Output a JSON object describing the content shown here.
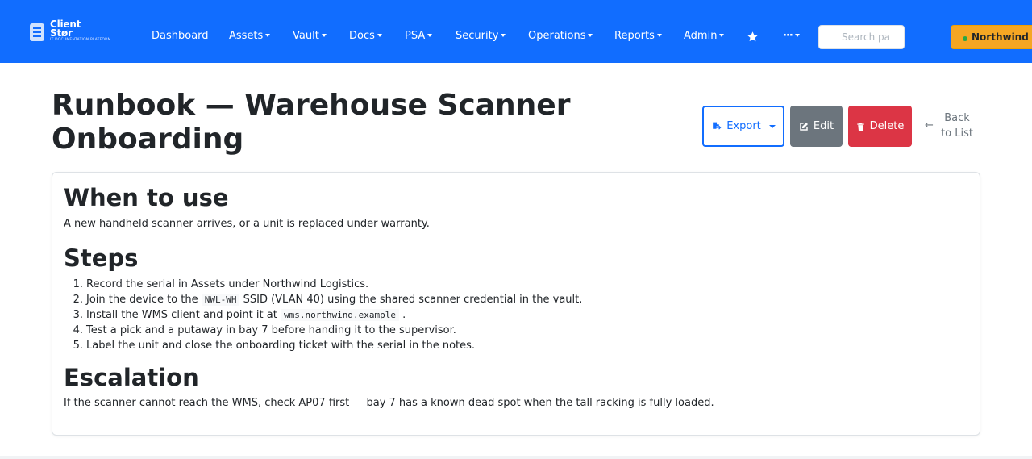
{
  "app": {
    "brand_name": "Client\nStør",
    "brand_tagline": "IT DOCUMENTATION PLATFORM"
  },
  "nav": {
    "items": [
      {
        "label": "Dashboard",
        "dropdown": false
      },
      {
        "label": "Assets",
        "dropdown": true
      },
      {
        "label": "Vault",
        "dropdown": true
      },
      {
        "label": "Docs",
        "dropdown": true
      },
      {
        "label": "PSA",
        "dropdown": true
      },
      {
        "label": "Security",
        "dropdown": true
      },
      {
        "label": "Operations",
        "dropdown": true
      },
      {
        "label": "Reports",
        "dropdown": true
      },
      {
        "label": "Admin",
        "dropdown": true
      }
    ],
    "favorites_icon": "star-icon",
    "more_icon": "ellipsis-icon",
    "search_placeholder": "Search pa",
    "client_label": "Northwind L"
  },
  "page": {
    "title": "Runbook — Warehouse Scanner Onboarding",
    "export_label": "Export",
    "edit_label": "Edit",
    "delete_label": "Delete",
    "back_label": "Back to List"
  },
  "doc": {
    "when_heading": "When to use",
    "when_text": "A new handheld scanner arrives, or a unit is replaced under warranty.",
    "steps_heading": "Steps",
    "steps": [
      {
        "n": "1.",
        "before": "Record the serial in Assets under Northwind Logistics.",
        "code": "",
        "after": ""
      },
      {
        "n": "2.",
        "before": "Join the device to the ",
        "code": "NWL-WH",
        "after": " SSID (VLAN 40) using the shared scanner credential in the vault."
      },
      {
        "n": "3.",
        "before": "Install the WMS client and point it at ",
        "code": "wms.northwind.example",
        "after": " ."
      },
      {
        "n": "4.",
        "before": "Test a pick and a putaway in bay 7 before handing it to the supervisor.",
        "code": "",
        "after": ""
      },
      {
        "n": "5.",
        "before": "Label the unit and close the onboarding ticket with the serial in the notes.",
        "code": "",
        "after": ""
      }
    ],
    "escalation_heading": "Escalation",
    "escalation_text": "If the scanner cannot reach the WMS, check AP07 first — bay 7 has a known dead spot when the tall racking is fully loaded."
  },
  "colors": {
    "navbar": "#116dff",
    "client_badge": "#f5a623",
    "edit_button": "#6c757d",
    "delete_button": "#dc3545"
  }
}
